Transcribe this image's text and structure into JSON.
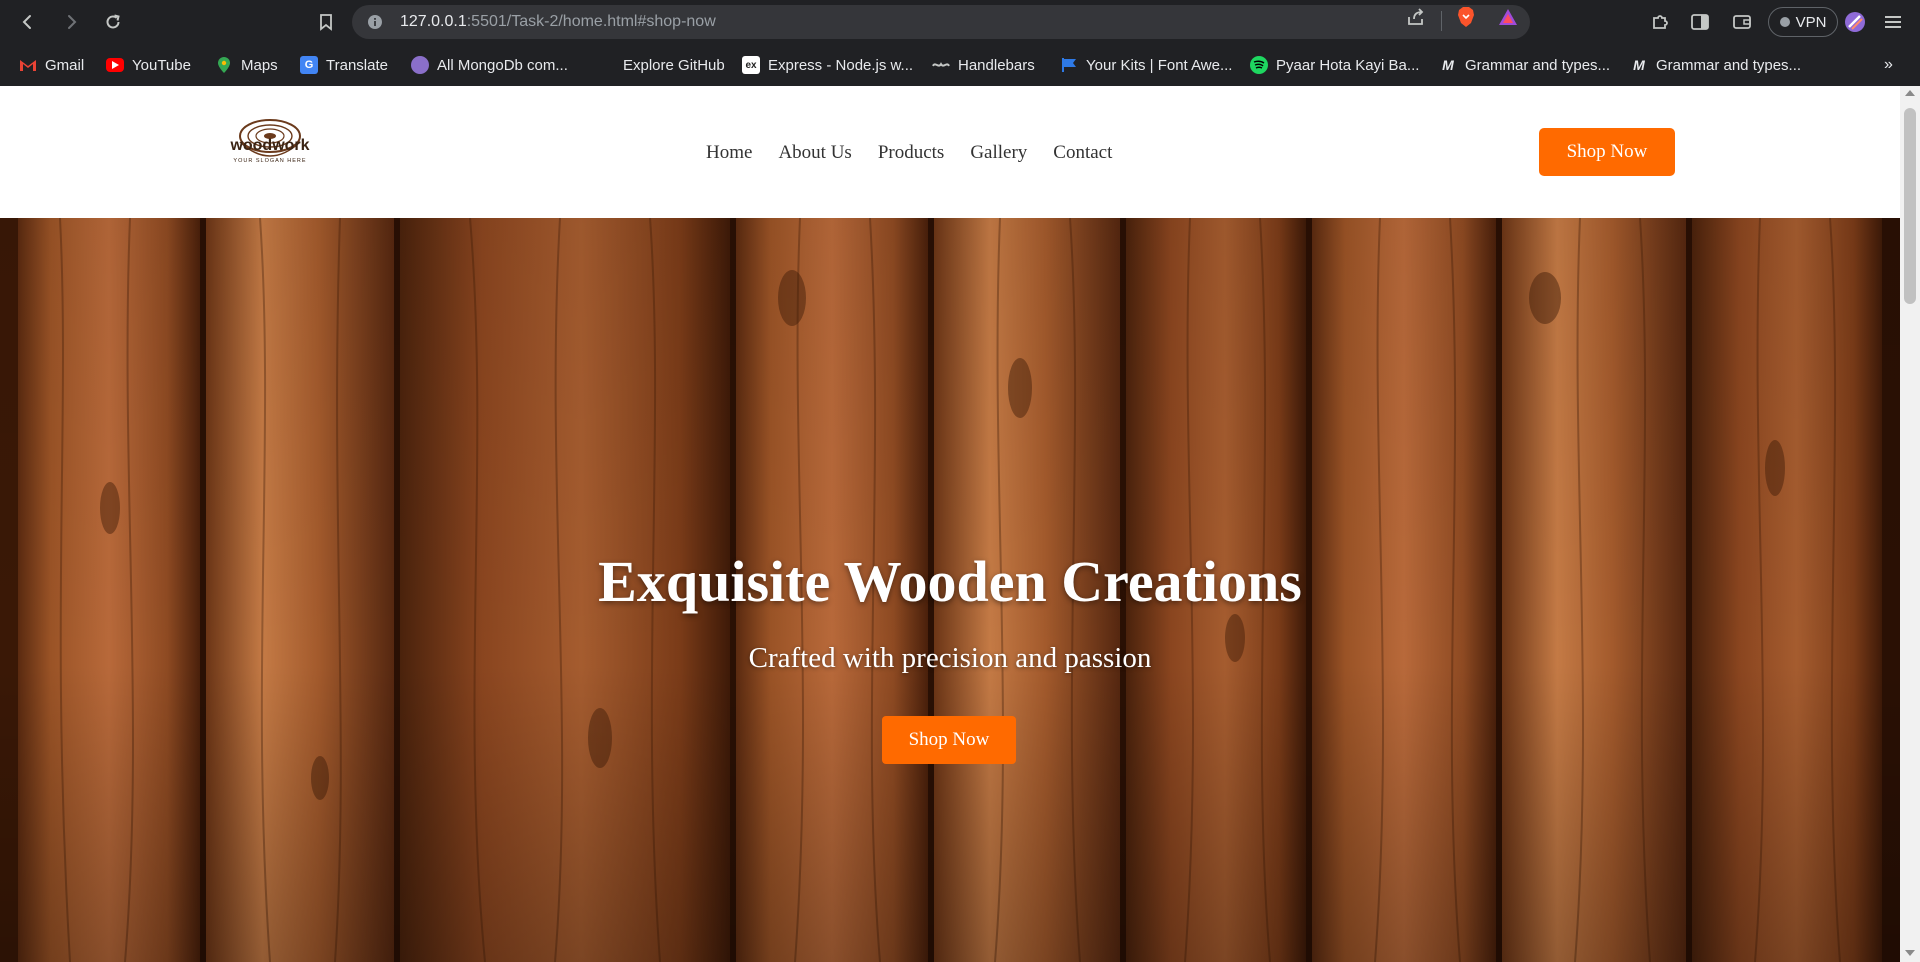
{
  "browser": {
    "url_host": "127.0.0.1",
    "url_rest": ":5501/Task-2/home.html#shop-now",
    "vpn_label": "VPN",
    "colors": {
      "chrome_bg": "#202124",
      "omnibox_bg": "#35363a"
    }
  },
  "bookmarks": [
    {
      "label": "Gmail",
      "icon": "gmail-icon"
    },
    {
      "label": "YouTube",
      "icon": "youtube-icon"
    },
    {
      "label": "Maps",
      "icon": "maps-icon"
    },
    {
      "label": "Translate",
      "icon": "translate-icon"
    },
    {
      "label": "All MongoDb com...",
      "icon": "avatar-icon"
    },
    {
      "label": "Explore GitHub",
      "icon": "github-icon"
    },
    {
      "label": "Express - Node.js w...",
      "icon": "express-icon"
    },
    {
      "label": "Handlebars",
      "icon": "handlebars-icon"
    },
    {
      "label": "Your Kits | Font Awe...",
      "icon": "fontawesome-icon"
    },
    {
      "label": "Pyaar Hota Kayi Ba...",
      "icon": "spotify-icon"
    },
    {
      "label": "Grammar and types...",
      "icon": "medium-icon"
    },
    {
      "label": "Grammar and types...",
      "icon": "medium-icon"
    }
  ],
  "bookmarks_overflow": "»",
  "site": {
    "logo": {
      "name": "woodwork",
      "slogan": "YOUR SLOGAN HERE"
    },
    "nav": [
      "Home",
      "About Us",
      "Products",
      "Gallery",
      "Contact"
    ],
    "cta_label": "Shop Now",
    "accent_color": "#ff6a00"
  },
  "hero": {
    "title": "Exquisite Wooden Creations",
    "subtitle": "Crafted with precision and passion",
    "cta_label": "Shop Now"
  }
}
